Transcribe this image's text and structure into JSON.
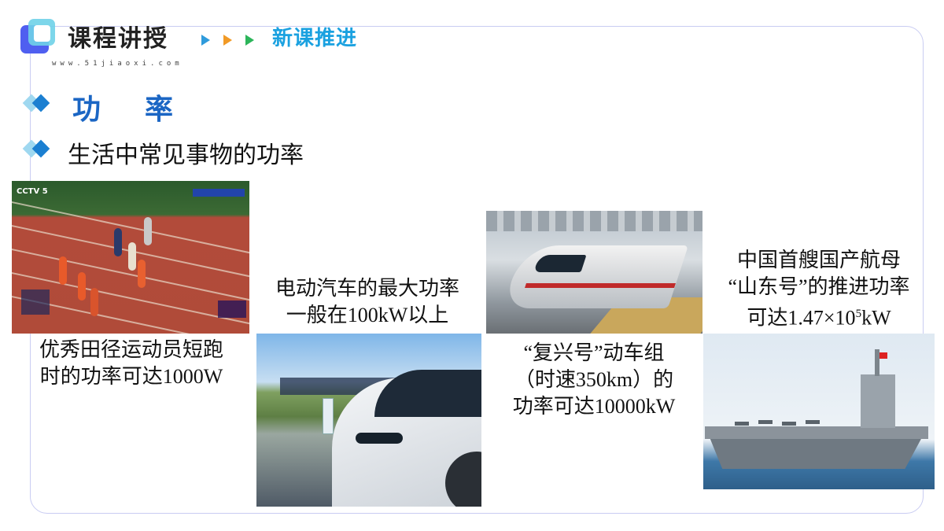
{
  "header": {
    "title": "课程讲授",
    "url": "www.51jiaoxi.com",
    "subtitle": "新课推进"
  },
  "section": {
    "heading": "功率",
    "subheading": "生活中常见事物的功率"
  },
  "cards": [
    {
      "photo": "sprinters-on-track",
      "caption_line1": "优秀田径运动员短跑",
      "caption_line2": "时的功率可达1000W"
    },
    {
      "photo": "electric-car-charging",
      "caption_line1": "电动汽车的最大功率",
      "caption_line2": "一般在100kW以上"
    },
    {
      "photo": "fuxing-bullet-train",
      "caption_line1": "“复兴号”动车组",
      "caption_line2": "（时速350km）的",
      "caption_line3": "功率可达10000kW"
    },
    {
      "photo": "shandong-aircraft-carrier",
      "caption_line1": "中国首艘国产航母",
      "caption_line2": "“山东号”的推进功率",
      "caption_line3_prefix": "可达1.47×10",
      "caption_line3_exp": "5",
      "caption_line3_suffix": "kW"
    }
  ],
  "colors": {
    "frame": "#c9ccf2",
    "heading": "#1b66c4",
    "subtitle": "#1aa1e0",
    "arrow_blue": "#2f9bdc",
    "arrow_orange": "#f19a26",
    "arrow_green": "#2cb55a"
  }
}
